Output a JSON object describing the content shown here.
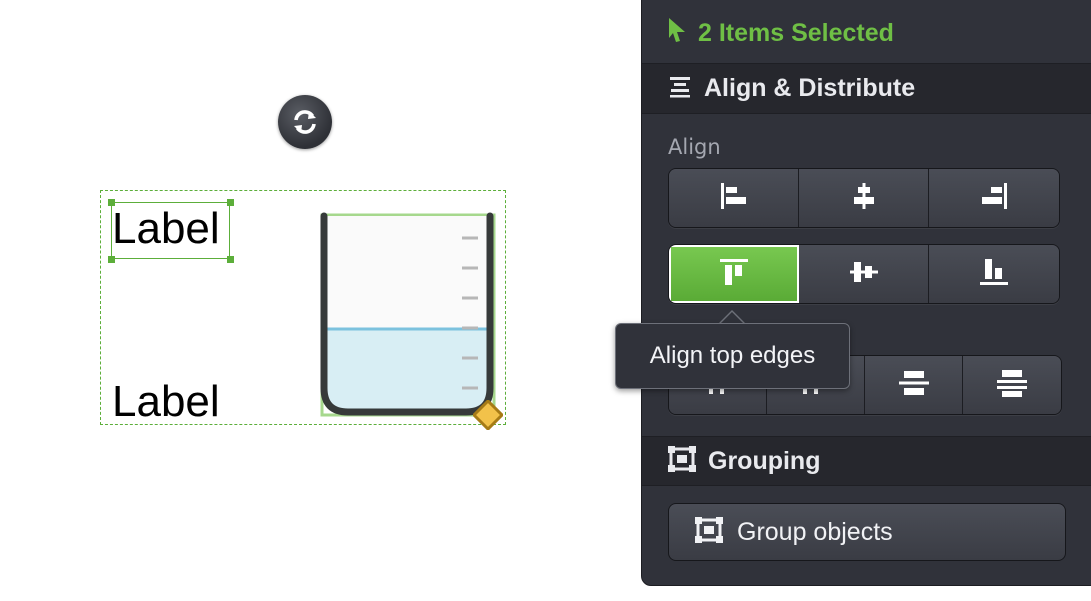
{
  "canvas": {
    "labels": [
      "Label",
      "Label"
    ],
    "rotate_icon": "rotate-icon",
    "beaker_icon": "beaker-shape",
    "resize_icon": "diamond-resize-handle"
  },
  "panel": {
    "header_title": "2 Items Selected",
    "align_section": {
      "title": "Align & Distribute",
      "align_label": "Align"
    },
    "align_row1": [
      "align-left-edges",
      "align-horizontal-centers",
      "align-right-edges"
    ],
    "align_row2": [
      "align-top-edges",
      "align-vertical-centers",
      "align-bottom-edges"
    ],
    "distribute_row": [
      "distribute-1",
      "distribute-2",
      "distribute-3",
      "distribute-4"
    ],
    "grouping_section": {
      "title": "Grouping",
      "group_button": "Group objects"
    }
  },
  "tooltip": {
    "text": "Align top edges"
  },
  "colors": {
    "accent_green": "#6fbf45",
    "active_button": "#69bb44",
    "panel_bg": "#30323a",
    "selection": "#5cae3a"
  }
}
